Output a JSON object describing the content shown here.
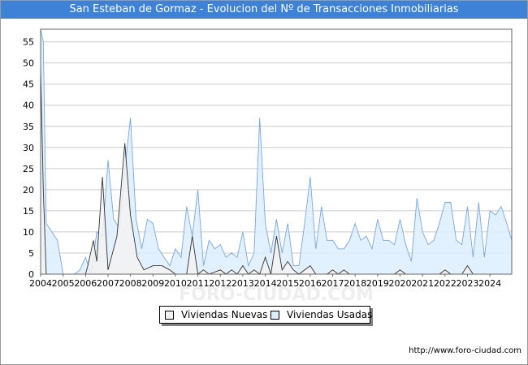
{
  "title": "San Esteban de Gormaz - Evolucion del Nº de Transacciones Inmobiliarias",
  "source_url": "http://www.foro-ciudad.com",
  "watermark": "FORO-CIUDAD.COM",
  "colors": {
    "title_bg": "#3e82d8",
    "nuevas_fill": "#f2f2f2",
    "nuevas_line": "#333333",
    "usadas_fill": "#ddeeff",
    "usadas_line": "#7aa6e0",
    "grid": "#cccccc"
  },
  "chart_data": {
    "type": "area",
    "title": "San Esteban de Gormaz - Evolucion del Nº de Transacciones Inmobiliarias",
    "xlabel": "",
    "ylabel": "",
    "ylim": [
      0,
      58
    ],
    "xlim": [
      2004,
      2024.97
    ],
    "yticks": [
      0,
      5,
      10,
      15,
      20,
      25,
      30,
      35,
      40,
      45,
      50,
      55
    ],
    "xticks": [
      "2004",
      "2005",
      "2006",
      "2007",
      "2008",
      "2009",
      "2010",
      "2011",
      "2012",
      "2013",
      "2014",
      "2015",
      "2016",
      "2017",
      "2018",
      "2019",
      "2020",
      "2021",
      "2022",
      "2023",
      "2024"
    ],
    "grid": "horizontal",
    "legend_position": "bottom",
    "series": [
      {
        "name": "Viviendas Nuevas",
        "points": [
          [
            2004.0,
            49
          ],
          [
            2004.12,
            20
          ],
          [
            2004.25,
            0
          ],
          [
            2006.0,
            0
          ],
          [
            2006.1,
            2
          ],
          [
            2006.35,
            8
          ],
          [
            2006.5,
            3
          ],
          [
            2006.75,
            23
          ],
          [
            2007.0,
            1
          ],
          [
            2007.4,
            9
          ],
          [
            2007.75,
            31
          ],
          [
            2008.0,
            14
          ],
          [
            2008.3,
            4
          ],
          [
            2008.6,
            1
          ],
          [
            2009.0,
            2
          ],
          [
            2009.4,
            2
          ],
          [
            2009.75,
            1
          ],
          [
            2010.0,
            0
          ],
          [
            2010.5,
            0
          ],
          [
            2010.75,
            9
          ],
          [
            2011.0,
            0
          ],
          [
            2011.25,
            1
          ],
          [
            2011.5,
            0
          ],
          [
            2012.0,
            1
          ],
          [
            2012.25,
            0
          ],
          [
            2012.5,
            1
          ],
          [
            2012.75,
            0
          ],
          [
            2013.0,
            2
          ],
          [
            2013.25,
            0
          ],
          [
            2013.5,
            1
          ],
          [
            2013.75,
            0
          ],
          [
            2014.0,
            4
          ],
          [
            2014.25,
            0
          ],
          [
            2014.5,
            9
          ],
          [
            2014.75,
            1
          ],
          [
            2015.0,
            3
          ],
          [
            2015.25,
            1
          ],
          [
            2015.5,
            0
          ],
          [
            2016.0,
            2
          ],
          [
            2016.25,
            0
          ],
          [
            2016.75,
            0
          ],
          [
            2017.0,
            1
          ],
          [
            2017.25,
            0
          ],
          [
            2017.5,
            1
          ],
          [
            2017.75,
            0
          ],
          [
            2019.75,
            0
          ],
          [
            2020.0,
            1
          ],
          [
            2020.25,
            0
          ],
          [
            2021.75,
            0
          ],
          [
            2022.0,
            1
          ],
          [
            2022.25,
            0
          ],
          [
            2022.75,
            0
          ],
          [
            2023.0,
            2
          ],
          [
            2023.25,
            0
          ],
          [
            2024.97,
            0
          ]
        ]
      },
      {
        "name": "Viviendas Usadas",
        "points": [
          [
            2004.0,
            58
          ],
          [
            2004.12,
            55
          ],
          [
            2004.25,
            12
          ],
          [
            2004.5,
            10
          ],
          [
            2004.75,
            8
          ],
          [
            2005.0,
            0
          ],
          [
            2005.25,
            0
          ],
          [
            2005.5,
            0
          ],
          [
            2005.75,
            1
          ],
          [
            2006.0,
            4
          ],
          [
            2006.25,
            0
          ],
          [
            2006.5,
            10
          ],
          [
            2006.75,
            9
          ],
          [
            2007.0,
            27
          ],
          [
            2007.25,
            13
          ],
          [
            2007.5,
            11
          ],
          [
            2007.75,
            25
          ],
          [
            2008.0,
            37
          ],
          [
            2008.25,
            13
          ],
          [
            2008.5,
            6
          ],
          [
            2008.75,
            13
          ],
          [
            2009.0,
            12
          ],
          [
            2009.25,
            6
          ],
          [
            2009.5,
            4
          ],
          [
            2009.75,
            2
          ],
          [
            2010.0,
            6
          ],
          [
            2010.25,
            4
          ],
          [
            2010.5,
            16
          ],
          [
            2010.75,
            9
          ],
          [
            2011.0,
            20
          ],
          [
            2011.25,
            2
          ],
          [
            2011.5,
            8
          ],
          [
            2011.75,
            6
          ],
          [
            2012.0,
            7
          ],
          [
            2012.25,
            4
          ],
          [
            2012.5,
            5
          ],
          [
            2012.75,
            4
          ],
          [
            2013.0,
            10
          ],
          [
            2013.25,
            2
          ],
          [
            2013.5,
            5
          ],
          [
            2013.75,
            37
          ],
          [
            2014.0,
            12
          ],
          [
            2014.25,
            5
          ],
          [
            2014.5,
            13
          ],
          [
            2014.75,
            5
          ],
          [
            2015.0,
            12
          ],
          [
            2015.25,
            2
          ],
          [
            2015.5,
            2
          ],
          [
            2015.75,
            12
          ],
          [
            2016.0,
            23
          ],
          [
            2016.25,
            6
          ],
          [
            2016.5,
            16
          ],
          [
            2016.75,
            8
          ],
          [
            2017.0,
            8
          ],
          [
            2017.25,
            6
          ],
          [
            2017.5,
            6
          ],
          [
            2017.75,
            8
          ],
          [
            2018.0,
            12
          ],
          [
            2018.25,
            8
          ],
          [
            2018.5,
            9
          ],
          [
            2018.75,
            6
          ],
          [
            2019.0,
            13
          ],
          [
            2019.25,
            8
          ],
          [
            2019.5,
            8
          ],
          [
            2019.75,
            7
          ],
          [
            2020.0,
            13
          ],
          [
            2020.25,
            7
          ],
          [
            2020.5,
            3
          ],
          [
            2020.75,
            18
          ],
          [
            2021.0,
            10
          ],
          [
            2021.25,
            7
          ],
          [
            2021.5,
            8
          ],
          [
            2021.75,
            12
          ],
          [
            2022.0,
            17
          ],
          [
            2022.25,
            17
          ],
          [
            2022.5,
            8
          ],
          [
            2022.75,
            7
          ],
          [
            2023.0,
            16
          ],
          [
            2023.25,
            4
          ],
          [
            2023.5,
            17
          ],
          [
            2023.75,
            4
          ],
          [
            2024.0,
            15
          ],
          [
            2024.25,
            14
          ],
          [
            2024.5,
            16
          ],
          [
            2024.75,
            12
          ],
          [
            2024.97,
            8
          ]
        ]
      }
    ]
  }
}
